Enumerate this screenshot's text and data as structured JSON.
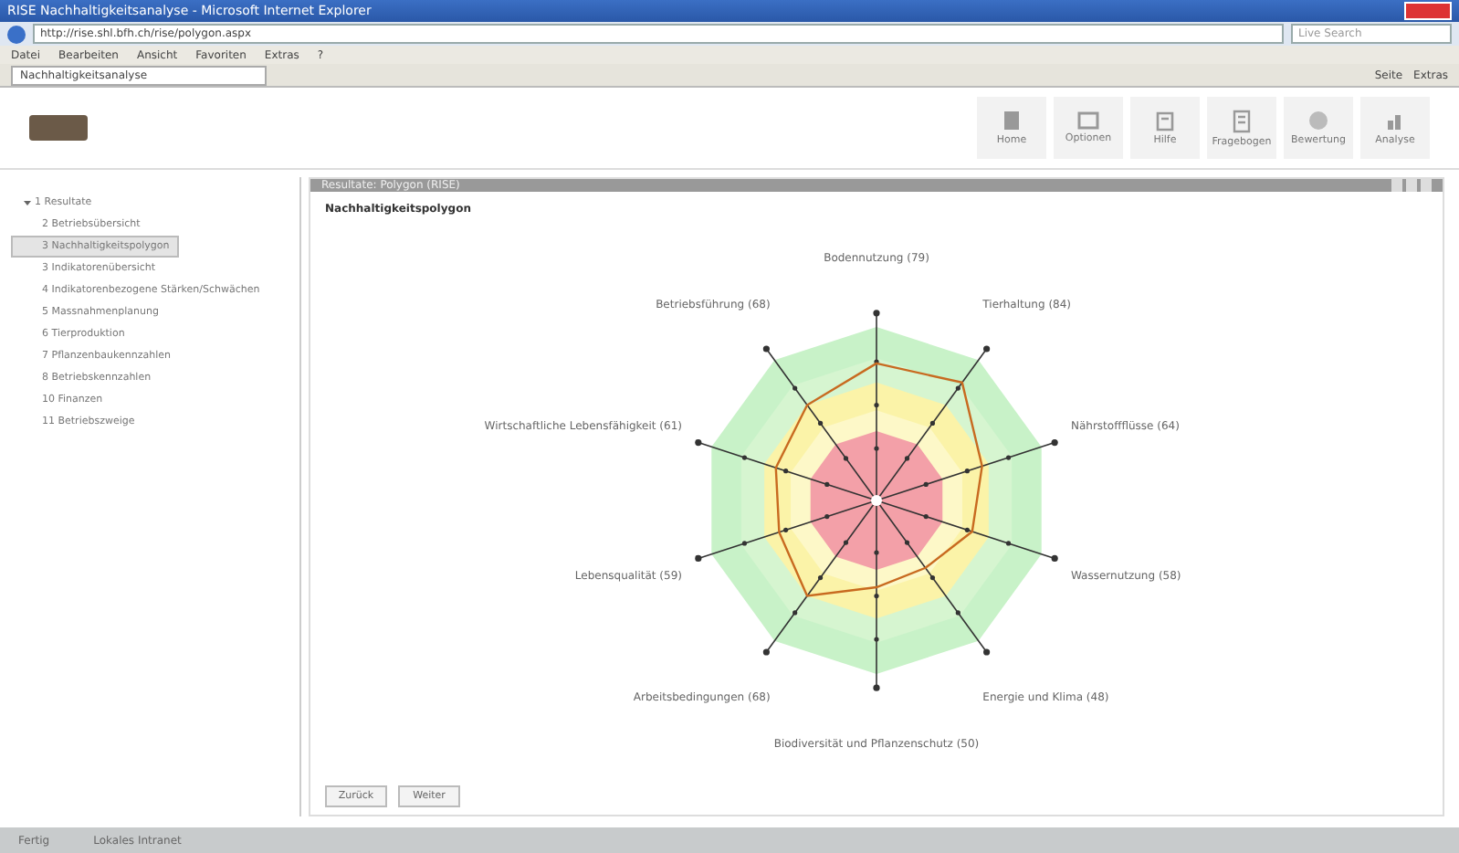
{
  "window": {
    "title": "RISE Nachhaltigkeitsanalyse - Microsoft Internet Explorer"
  },
  "address_bar": {
    "url": "http://rise.shl.bfh.ch/rise/polygon.aspx",
    "search_placeholder": "Live Search"
  },
  "menu": [
    "Datei",
    "Bearbeiten",
    "Ansicht",
    "Favoriten",
    "Extras",
    "?"
  ],
  "browser_tabs": [
    {
      "label": "Nachhaltigkeitsanalyse",
      "selected": true
    }
  ],
  "browser_tools": [
    "Seite",
    "Extras"
  ],
  "toolbar": [
    {
      "label": "Home",
      "kind": "home"
    },
    {
      "label": "Optionen",
      "kind": "options"
    },
    {
      "label": "Hilfe",
      "kind": "help"
    },
    {
      "label": "Fragebogen",
      "kind": "form"
    },
    {
      "label": "Bewertung",
      "kind": "globe"
    },
    {
      "label": "Analyse",
      "kind": "chart"
    }
  ],
  "sidebar": {
    "items": [
      {
        "label": "1 Resultate",
        "expanded": true,
        "selected": false,
        "children": [
          {
            "label": "2 Betriebsübersicht",
            "selected": false
          },
          {
            "label": "3 Nachhaltigkeitspolygon",
            "selected": true
          },
          {
            "label": "3 Indikatorenübersicht",
            "selected": false
          },
          {
            "label": "4 Indikatorenbezogene Stärken/Schwächen",
            "selected": false
          },
          {
            "label": "5 Massnahmenplanung",
            "selected": false
          },
          {
            "label": "6 Tierproduktion",
            "selected": false
          },
          {
            "label": "7 Pflanzenbaukennzahlen",
            "selected": false
          },
          {
            "label": "8 Betriebskennzahlen",
            "selected": false
          },
          {
            "label": "10 Finanzen",
            "selected": false
          },
          {
            "label": "11 Betriebszweige",
            "selected": false
          }
        ]
      }
    ]
  },
  "panel": {
    "title": "Resultate: Polygon (RISE)",
    "section": "Nachhaltigkeitspolygon",
    "axes": [
      "Bodennutzung (79)",
      "Betriebsführung (68)",
      "Tierhaltung (84)",
      "Wirtschaftliche Lebensfähigkeit (61)",
      "Nährstoffflüsse (64)",
      "Lebensqualität (59)",
      "Wassernutzung (58)",
      "Arbeitsbedingungen (68)",
      "Energie und Klima (48)",
      "Biodiversität und Pflanzenschutz (50)"
    ],
    "buttons": [
      "Zurück",
      "Weiter"
    ]
  },
  "status_bar": {
    "left": "Fertig",
    "zone": "Lokales Intranet"
  }
}
